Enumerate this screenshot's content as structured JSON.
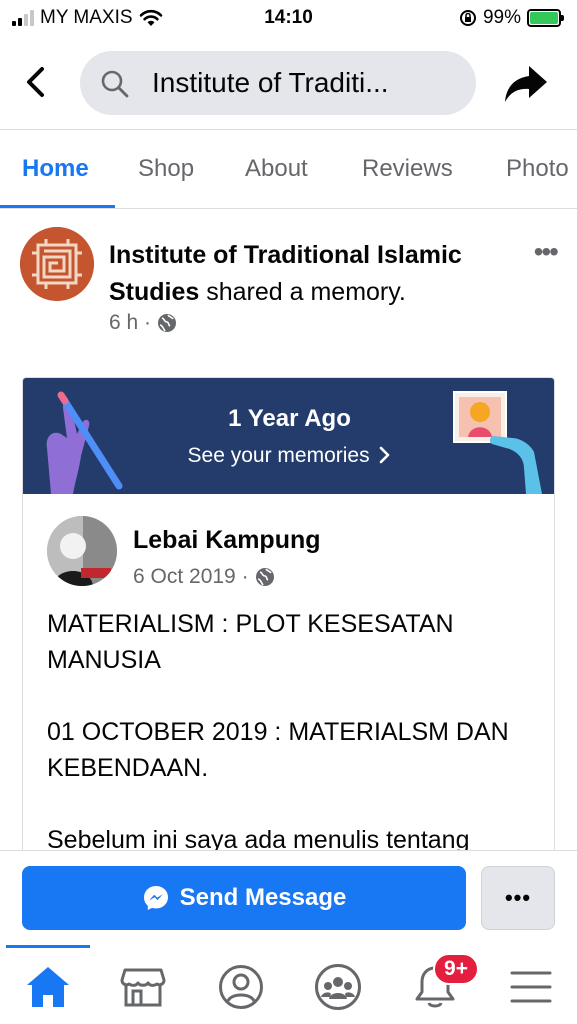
{
  "status_bar": {
    "carrier": "MY MAXIS",
    "time": "14:10",
    "battery": "99%",
    "battery_color": "#34c759"
  },
  "header": {
    "search_text": "Institute of Traditi...",
    "back_icon": "chevron-left-icon",
    "share_icon": "share-arrow-icon"
  },
  "tabs": [
    {
      "label": "Home",
      "active": true
    },
    {
      "label": "Shop"
    },
    {
      "label": "About"
    },
    {
      "label": "Reviews"
    },
    {
      "label": "Photo"
    }
  ],
  "post": {
    "page_name": "Institute of Traditional Islamic Studies",
    "action": " shared a memory.",
    "time": "6 h ·"
  },
  "memory": {
    "title": "1 Year Ago",
    "subtitle": "See your memories"
  },
  "inner_post": {
    "author": "Lebai Kampung",
    "date": "6 Oct 2019 ·",
    "paragraphs": [
      "MATERIALISM : PLOT KESESATAN MANUSIA",
      "01 OCTOBER 2019 : MATERIALSM DAN KEBENDAAN.",
      "Sebelum ini saya ada menulis tentang"
    ]
  },
  "actions": {
    "send_message": "Send Message",
    "more": "•••"
  },
  "bottom_nav": {
    "items": [
      "home-icon",
      "marketplace-icon",
      "profile-icon",
      "groups-icon",
      "notifications-icon",
      "menu-icon"
    ],
    "notification_badge": "9+"
  },
  "colors": {
    "brand_blue": "#1877f2",
    "banner_navy": "#243c6b",
    "badge_red": "#e41e3f"
  }
}
